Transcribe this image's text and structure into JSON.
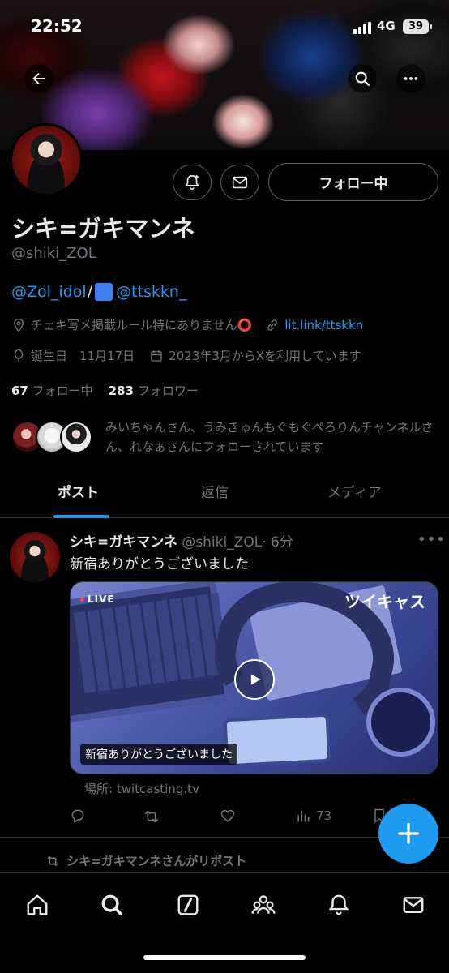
{
  "status_bar": {
    "time": "22:52",
    "network": "4G",
    "battery": "39"
  },
  "profile": {
    "name": "シキ=ガキマンネ",
    "handle": "@shiki_ZOL",
    "follow_button": "フォロー中",
    "bio": {
      "link1": "@Zol_idol",
      "separator": "/",
      "link2": "@ttskkn_"
    },
    "location": "チェキ写メ掲載ルール特にありません⭕️",
    "website": "lit.link/ttskkn",
    "birthday": "誕生日　11月17日",
    "joined": "2023年3月からXを利用しています",
    "following_count": "67",
    "following_label": "フォロー中",
    "followers_count": "283",
    "followers_label": "フォロワー",
    "followed_by": "みいちゃんさん、うみきゅんもぐもぐぺろりんチャンネルさん、れなぁさんにフォローされています"
  },
  "tabs": [
    {
      "label": "ポスト",
      "active": true
    },
    {
      "label": "返信",
      "active": false
    },
    {
      "label": "メディア",
      "active": false
    }
  ],
  "tweet": {
    "author_name": "シキ=ガキマンネ",
    "author_handle": "@shiki_ZOL",
    "time": "· 6分",
    "text": "新宿ありがとうございました",
    "card": {
      "live_badge": "LIVE",
      "brand": "ツイキャス",
      "caption": "新宿ありがとうございました",
      "source": "場所: twitcasting.tv"
    },
    "views": "73"
  },
  "repost_label": "シキ=ガキマンネさんがリポスト",
  "icons": {
    "back": "arrow-left-icon",
    "search": "search-icon",
    "more": "more-icon",
    "notify": "bell-plus-icon",
    "message": "envelope-icon",
    "location": "pin-icon",
    "link": "link-icon",
    "birthday": "balloon-icon",
    "calendar": "calendar-icon"
  },
  "colors": {
    "accent": "#1d9bf0",
    "text": "#e7e9ea",
    "muted": "#71767b",
    "border": "#2f3336"
  }
}
